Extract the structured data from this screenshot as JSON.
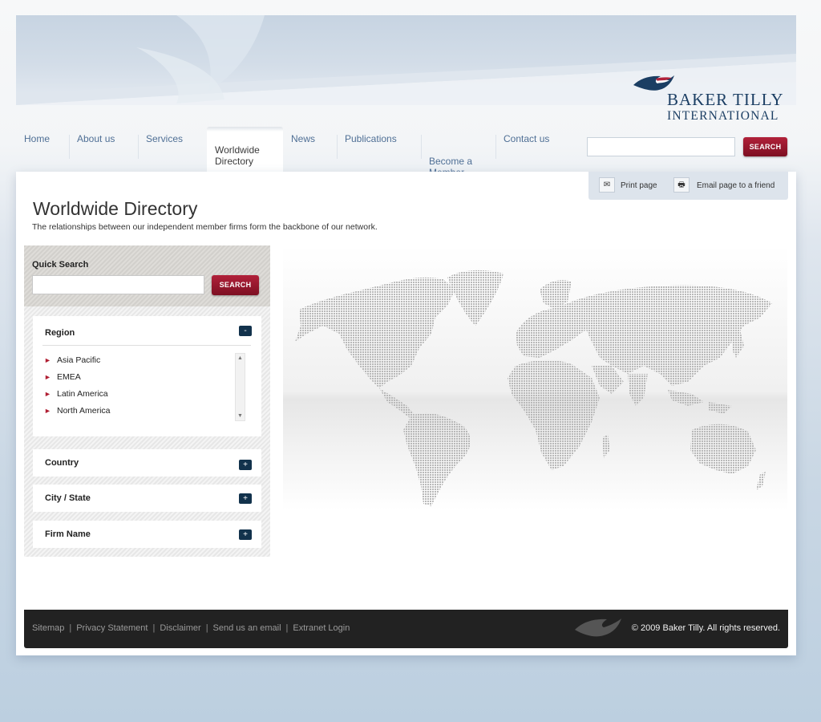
{
  "brand": {
    "line1": "BAKER TILLY",
    "line2": "INTERNATIONAL",
    "navy": "#1b3e63",
    "red": "#b1213a"
  },
  "nav": {
    "items": [
      {
        "label": "Home"
      },
      {
        "label": "About us"
      },
      {
        "label": "Services"
      },
      {
        "label": "Worldwide\nDirectory",
        "active": true
      },
      {
        "label": "News"
      },
      {
        "label": "Publications"
      },
      {
        "label": "Become a\nMember"
      },
      {
        "label": "Contact us"
      }
    ],
    "search_value": "",
    "search_button": "SEARCH"
  },
  "tools": {
    "print_label": "Print page",
    "email_label": "Email page to a friend"
  },
  "page": {
    "title": "Worldwide Directory",
    "subtitle": "The relationships between our independent member firms form the backbone of our network."
  },
  "quick_search": {
    "label": "Quick Search",
    "value": "",
    "button": "SEARCH"
  },
  "filters": {
    "region": {
      "label": "Region",
      "toggle": "-",
      "items": [
        "Asia Pacific",
        "EMEA",
        "Latin America",
        "North America"
      ]
    },
    "country": {
      "label": "Country",
      "toggle": "+"
    },
    "city": {
      "label": "City / State",
      "toggle": "+"
    },
    "firm": {
      "label": "Firm Name",
      "toggle": "+"
    }
  },
  "footer": {
    "links": [
      "Sitemap",
      "Privacy Statement",
      "Disclaimer",
      "Send us an email",
      "Extranet Login"
    ],
    "copyright": "© 2009 Baker Tilly. All rights reserved."
  }
}
